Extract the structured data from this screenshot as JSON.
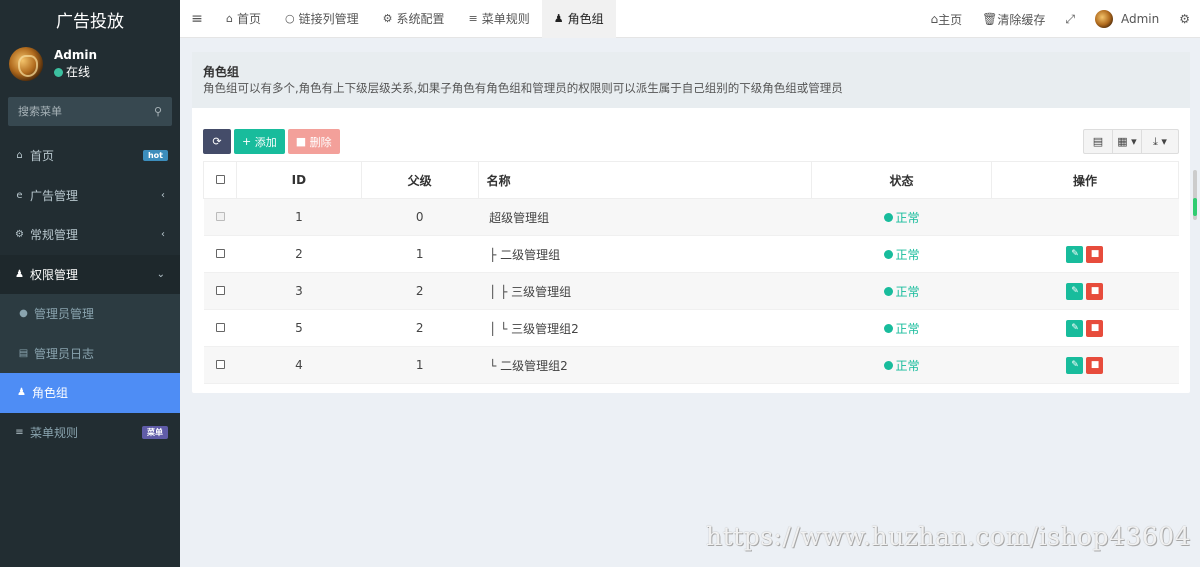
{
  "sidebar": {
    "brand": "广告投放",
    "user": {
      "name": "Admin",
      "status": "在线"
    },
    "search_placeholder": "搜索菜单",
    "items": [
      {
        "label": "首页",
        "icon": "home-icon",
        "badge": "hot"
      },
      {
        "label": "广告管理",
        "icon": "ie-icon"
      },
      {
        "label": "常规管理",
        "icon": "cogs-icon"
      },
      {
        "label": "权限管理",
        "icon": "group-icon"
      }
    ],
    "subitems": [
      {
        "label": "管理员管理",
        "icon": "user-icon"
      },
      {
        "label": "管理员日志",
        "icon": "list-icon"
      },
      {
        "label": "角色组",
        "icon": "group-icon"
      }
    ],
    "last_item": {
      "label": "菜单规则",
      "icon": "bars-icon",
      "badge": "菜单"
    }
  },
  "topnav": {
    "tabs": [
      {
        "label": "首页",
        "icon": "home-icon"
      },
      {
        "label": "链接列管理",
        "icon": "circle-icon"
      },
      {
        "label": "系统配置",
        "icon": "cog-icon"
      },
      {
        "label": "菜单规则",
        "icon": "bars-icon"
      },
      {
        "label": "角色组",
        "icon": "group-icon"
      }
    ],
    "right": {
      "home": "主页",
      "clear_cache": "清除缓存",
      "user": "Admin"
    }
  },
  "panel": {
    "title": "角色组",
    "description": "角色组可以有多个,角色有上下级层级关系,如果子角色有角色组和管理员的权限则可以派生属于自己组别的下级角色组或管理员"
  },
  "toolbar": {
    "add": "添加",
    "delete": "删除"
  },
  "table": {
    "headers": [
      "ID",
      "父级",
      "名称",
      "状态",
      "操作"
    ],
    "rows": [
      {
        "id": "1",
        "pid": "0",
        "name": "超级管理组",
        "status": "正常"
      },
      {
        "id": "2",
        "pid": "1",
        "name": "├ 二级管理组",
        "status": "正常"
      },
      {
        "id": "3",
        "pid": "2",
        "name": "│ ├ 三级管理组",
        "status": "正常"
      },
      {
        "id": "5",
        "pid": "2",
        "name": "│ └ 三级管理组2",
        "status": "正常"
      },
      {
        "id": "4",
        "pid": "1",
        "name": "└ 二级管理组2",
        "status": "正常"
      }
    ]
  },
  "watermark": "https://www.huzhan.com/ishop43604"
}
